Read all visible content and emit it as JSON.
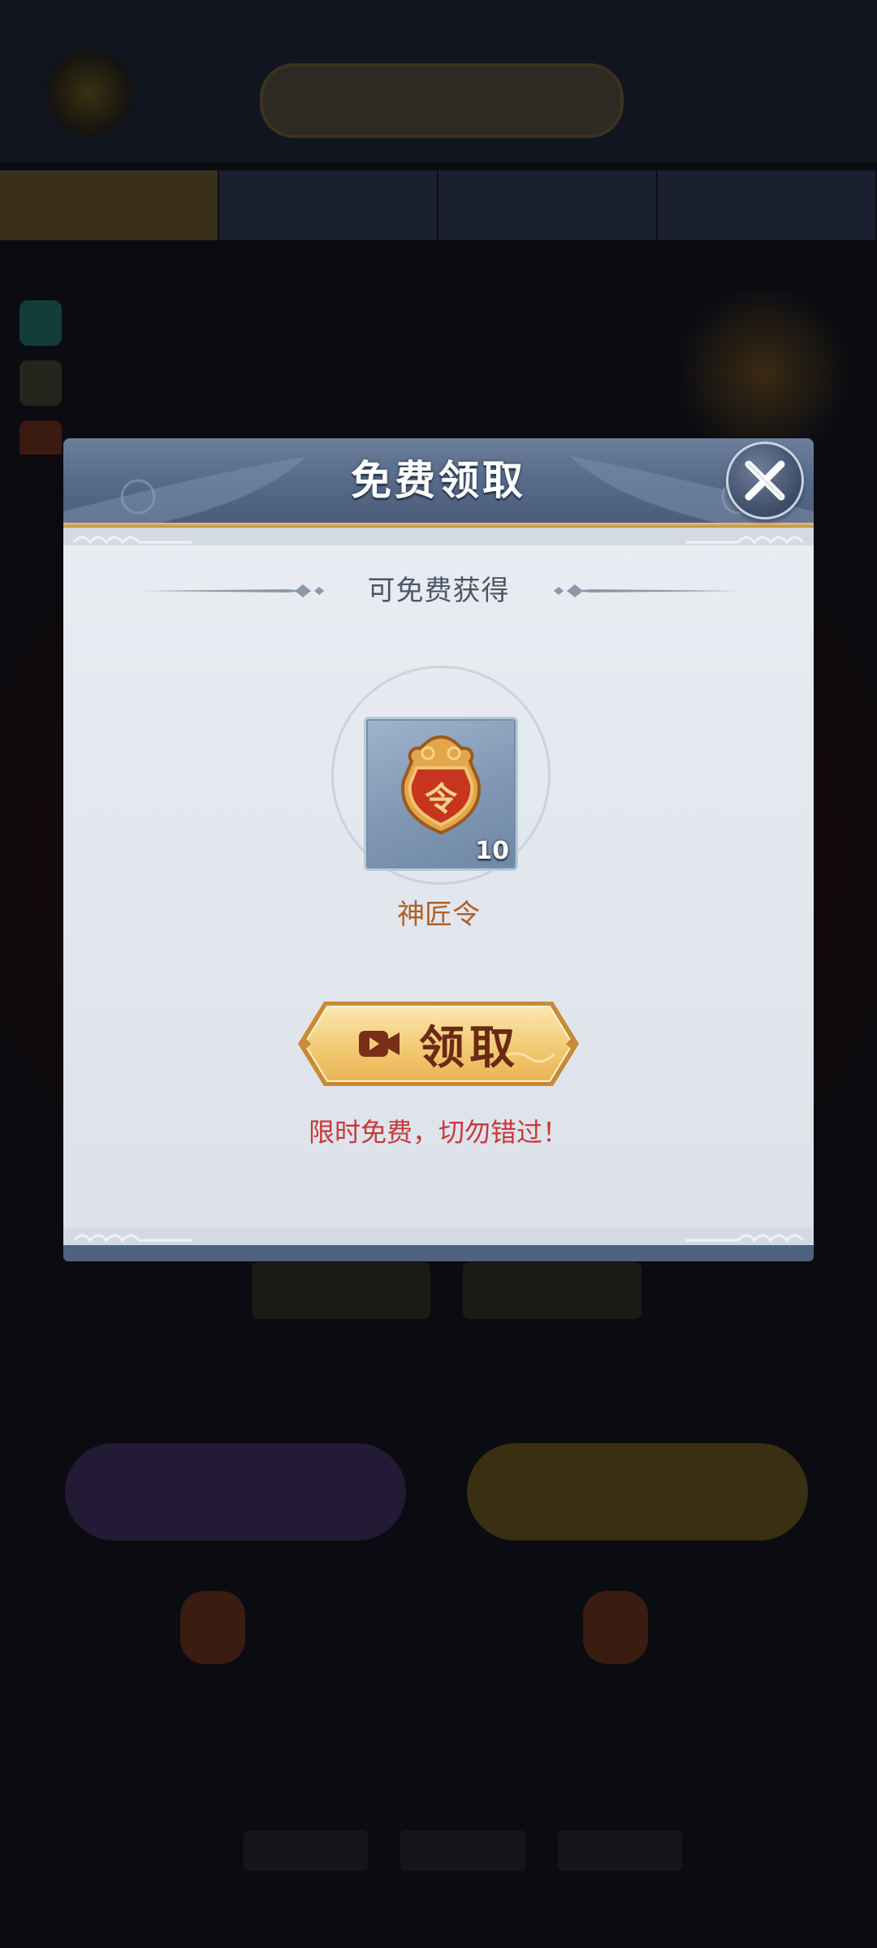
{
  "dialog": {
    "title": "免费领取",
    "section_label": "可免费获得",
    "reward": {
      "name": "神匠令",
      "count": "10",
      "icon": "token-badge-icon",
      "icon_glyph": "令"
    },
    "claim_button_label": "领取",
    "claim_button_icon": "video-camera-icon",
    "promo_text": "限时免费，切勿错过！",
    "close_icon": "close-icon"
  },
  "colors": {
    "header": "#566a88",
    "body": "#e1e6ed",
    "button_gold": "#f2cf7e",
    "promo_red": "#c8383a",
    "reward_name": "#b06028"
  }
}
